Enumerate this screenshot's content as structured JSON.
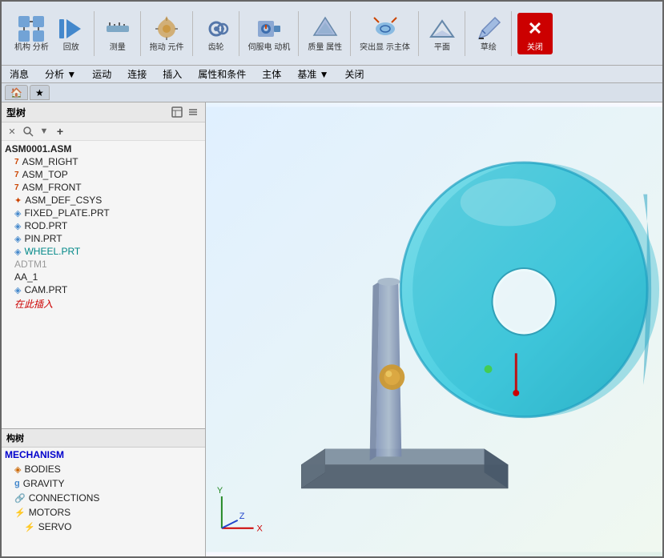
{
  "toolbar": {
    "groups": [
      {
        "buttons": [
          {
            "label": "机构\n分析",
            "icon": "⚙",
            "name": "mech-analysis"
          },
          {
            "label": "回放",
            "icon": "▶",
            "name": "playback"
          }
        ]
      },
      {
        "buttons": [
          {
            "label": "测量",
            "icon": "📏",
            "name": "measure"
          }
        ]
      },
      {
        "buttons": [
          {
            "label": "拖动\n元件",
            "icon": "✋",
            "name": "drag-component"
          }
        ]
      },
      {
        "buttons": [
          {
            "label": "齿轮",
            "icon": "⚙",
            "name": "gear"
          }
        ]
      },
      {
        "buttons": [
          {
            "label": "伺服电\n动机",
            "icon": "⚡",
            "name": "servo-motor"
          }
        ]
      },
      {
        "buttons": [
          {
            "label": "质量\n属性",
            "icon": "◆",
            "name": "mass-props"
          }
        ]
      },
      {
        "buttons": [
          {
            "label": "突出显\n示主体",
            "icon": "◈",
            "name": "highlight-body"
          }
        ]
      },
      {
        "buttons": [
          {
            "label": "平面",
            "icon": "▭",
            "name": "plane"
          }
        ]
      },
      {
        "buttons": [
          {
            "label": "草绘",
            "icon": "✏",
            "name": "sketch"
          }
        ]
      },
      {
        "buttons": [
          {
            "label": "关闭",
            "icon": "✕",
            "name": "close",
            "isClose": true
          }
        ]
      }
    ]
  },
  "menubar": {
    "items": [
      "消息",
      "分析 ▼",
      "运动",
      "连接",
      "插入",
      "属性和条件",
      "主体",
      "基准 ▼",
      "关闭"
    ]
  },
  "tabs": [
    {
      "label": "🏠",
      "active": false
    },
    {
      "label": "★",
      "active": false
    }
  ],
  "sidebar": {
    "title": "型树",
    "search_placeholder": "",
    "tree_items": [
      {
        "label": "ASM0001.ASM",
        "icon": "",
        "indent": 0,
        "style": "normal"
      },
      {
        "label": "ASM_RIGHT",
        "icon": "7",
        "indent": 1,
        "style": "normal"
      },
      {
        "label": "ASM_TOP",
        "icon": "7",
        "indent": 1,
        "style": "normal"
      },
      {
        "label": "ASM_FRONT",
        "icon": "7",
        "indent": 1,
        "style": "normal"
      },
      {
        "label": "ASM_DEF_CSYS",
        "icon": "✦",
        "indent": 1,
        "style": "normal"
      },
      {
        "label": "FIXED_PLATE.PRT",
        "icon": "◈",
        "indent": 1,
        "style": "normal"
      },
      {
        "label": "ROD.PRT",
        "icon": "◈",
        "indent": 1,
        "style": "normal"
      },
      {
        "label": "PIN.PRT",
        "icon": "◈",
        "indent": 1,
        "style": "normal"
      },
      {
        "label": "WHEEL.PRT",
        "icon": "◈",
        "indent": 1,
        "style": "cyan"
      },
      {
        "label": "ADTM1",
        "icon": "",
        "indent": 1,
        "style": "gray"
      },
      {
        "label": "AA_1",
        "icon": "",
        "indent": 1,
        "style": "normal"
      },
      {
        "label": "CAM.PRT",
        "icon": "◈",
        "indent": 1,
        "style": "normal"
      },
      {
        "label": "在此插入",
        "icon": "",
        "indent": 1,
        "style": "inserting"
      }
    ]
  },
  "mech_tree": {
    "title": "构树",
    "items": [
      {
        "label": "MECHANISM",
        "icon": "",
        "indent": 0,
        "style": "highlight"
      },
      {
        "label": "BODIES",
        "icon": "◈",
        "indent": 1,
        "style": "normal"
      },
      {
        "label": "GRAVITY",
        "icon": "g",
        "indent": 1,
        "style": "normal"
      },
      {
        "label": "CONNECTIONS",
        "icon": "🔗",
        "indent": 1,
        "style": "normal"
      },
      {
        "label": "MOTORS",
        "icon": "⚡",
        "indent": 1,
        "style": "normal"
      },
      {
        "label": "SERVO",
        "icon": "⚡",
        "indent": 2,
        "style": "normal"
      }
    ]
  },
  "icons": {
    "search": "🔍",
    "filter": "▼",
    "settings": "⚙",
    "add": "+",
    "close_small": "✕",
    "tree_expand": "►",
    "wrench": "🔧"
  }
}
